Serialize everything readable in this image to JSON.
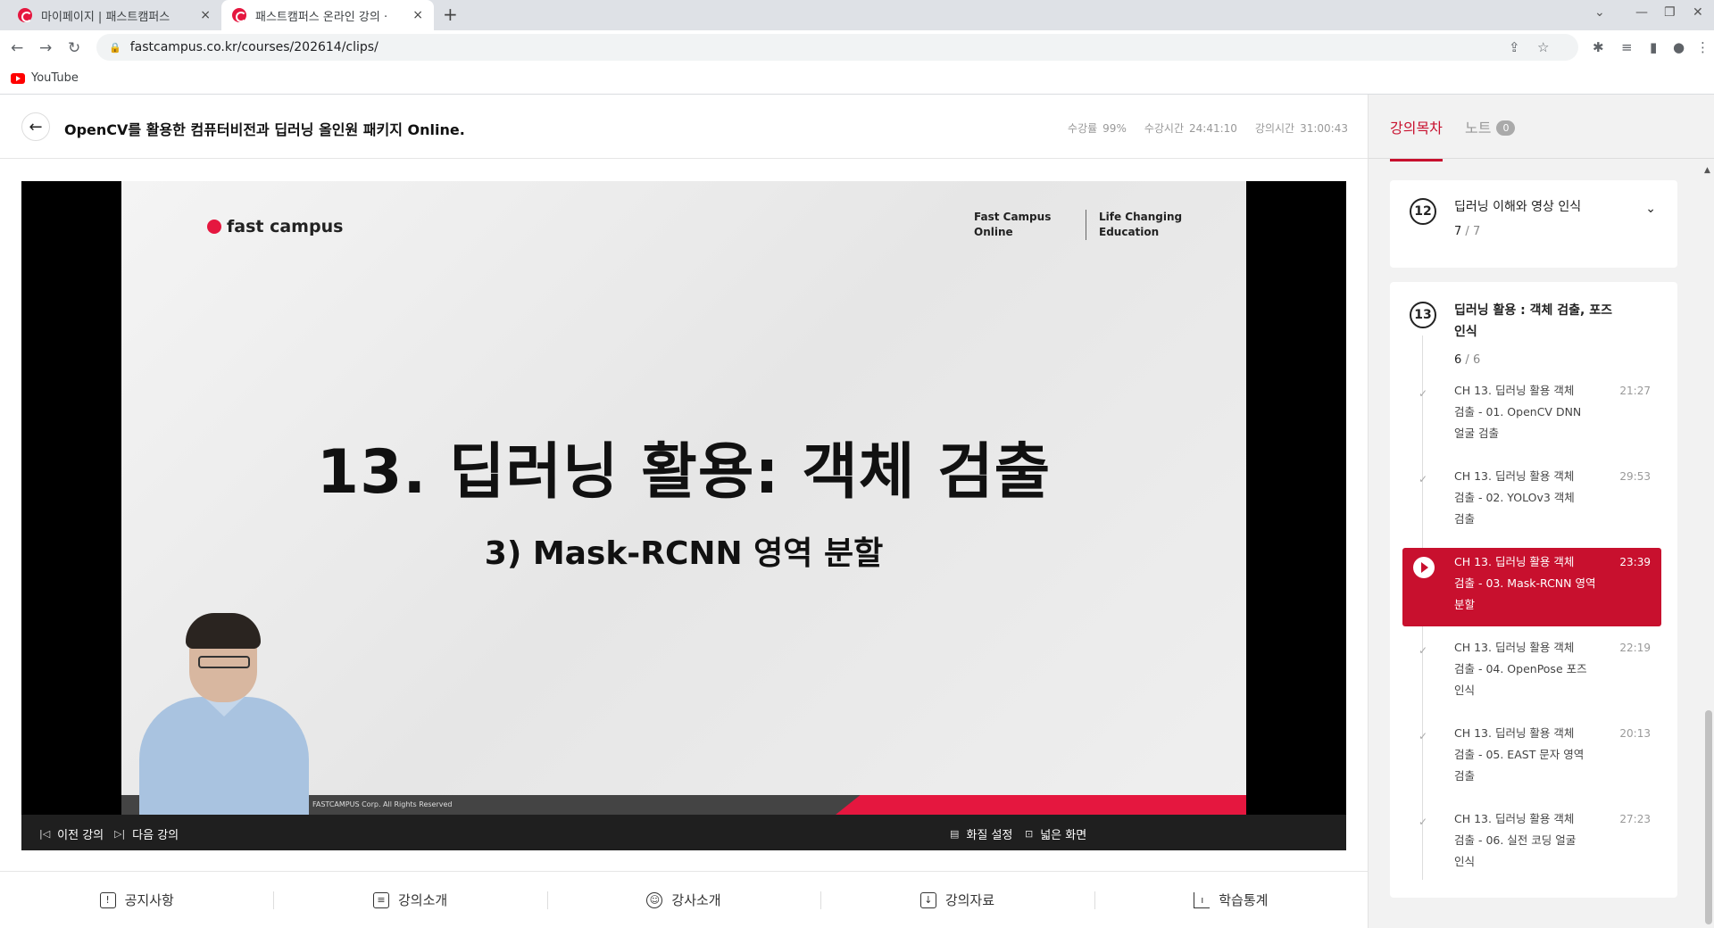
{
  "browser": {
    "tabs": [
      {
        "title": "마이페이지 | 패스트캠퍼스",
        "active": false
      },
      {
        "title": "패스트캠퍼스 온라인 강의 ·",
        "active": true
      }
    ],
    "new_tab_glyph": "+",
    "close_glyph": "×",
    "url": "fastcampus.co.kr/courses/202614/clips/",
    "bookmarks": [
      {
        "label": "YouTube",
        "icon": "youtube-icon"
      }
    ]
  },
  "header": {
    "course_title": "OpenCV를 활용한 컴퓨터비전과 딥러닝 올인원 패키지 Online.",
    "progress_label": "수강률",
    "progress_value": "99%",
    "watched_label": "수강시간",
    "watched_value": "24:41:10",
    "total_label": "강의시간",
    "total_value": "31:00:43"
  },
  "video": {
    "slide_brand": "fast campus",
    "slide_tag_1a": "Fast Campus",
    "slide_tag_1b": "Online",
    "slide_tag_2a": "Life Changing",
    "slide_tag_2b": "Education",
    "slide_title": "13. 딥러닝 활용: 객체 검출",
    "slide_subtitle": "3) Mask-RCNN 영역 분할",
    "slide_footer": "FASTCAMPUS Corp. All Rights Reserved",
    "prev_label": "이전 강의",
    "next_label": "다음 강의",
    "quality_label": "화질 설정",
    "wide_label": "넓은 화면"
  },
  "bottom_tabs": [
    {
      "label": "공지사항",
      "icon": "notice-icon"
    },
    {
      "label": "강의소개",
      "icon": "clipboard-icon"
    },
    {
      "label": "강사소개",
      "icon": "user-icon"
    },
    {
      "label": "강의자료",
      "icon": "download-icon"
    },
    {
      "label": "학습통계",
      "icon": "chart-icon"
    }
  ],
  "sidebar": {
    "tab_toc": "강의목차",
    "tab_notes": "노트",
    "notes_count": "0",
    "chapters": [
      {
        "num": "12",
        "title": "딥러닝 이해와 영상 인식",
        "done": "7",
        "total": "7"
      },
      {
        "num": "13",
        "title_line1": "딥러닝 활용 : 객체 검출, 포즈",
        "title_line2": "인식",
        "done": "6",
        "total": "6"
      }
    ],
    "lessons": [
      {
        "l1": "CH 13. 딥러닝 활용 객체",
        "l2": "검출 - 01. OpenCV DNN",
        "l3": "얼굴 검출",
        "dur": "21:27"
      },
      {
        "l1": "CH 13. 딥러닝 활용 객체",
        "l2": "검출 - 02. YOLOv3 객체",
        "l3": "검출",
        "dur": "29:53"
      },
      {
        "l1": "CH 13. 딥러닝 활용 객체",
        "l2": "검출 - 03. Mask-RCNN 영역",
        "l3": "분할",
        "dur": "23:39"
      },
      {
        "l1": "CH 13. 딥러닝 활용 객체",
        "l2": "검출 - 04. OpenPose 포즈",
        "l3": "인식",
        "dur": "22:19"
      },
      {
        "l1": "CH 13. 딥러닝 활용 객체",
        "l2": "검출 - 05. EAST 문자 영역",
        "l3": "검출",
        "dur": "20:13"
      },
      {
        "l1": "CH 13. 딥러닝 활용 객체",
        "l2": "검출 - 06. 실전 코딩 얼굴",
        "l3": "인식",
        "dur": "27:23"
      }
    ],
    "accent_color": "#c8102e"
  }
}
